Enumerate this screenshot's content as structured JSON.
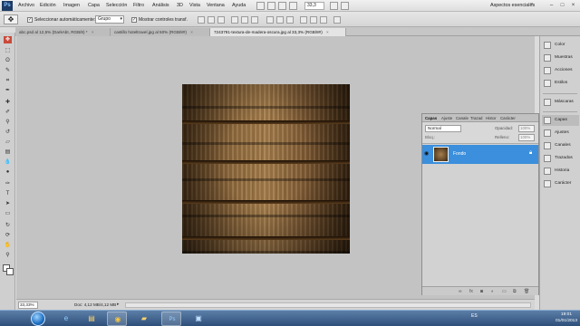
{
  "menubar": {
    "logo": "Ps",
    "items": [
      "Archivo",
      "Edición",
      "Imagen",
      "Capa",
      "Selección",
      "Filtro",
      "Análisis",
      "3D",
      "Vista",
      "Ventana",
      "Ayuda"
    ],
    "zoom": "33,3",
    "workspace": "Aspectos esenciales",
    "controls": [
      "–",
      "□",
      "×"
    ]
  },
  "options": {
    "preset_icon": "move-tool-icon",
    "auto_select_label": "Seleccionar automáticamente:",
    "auto_select_value": "Grupo",
    "show_transform_label": "Mostrar controles transf."
  },
  "tabs": [
    {
      "label": "abc.psd al 12,5% (DarkAbt, RGB/8) *",
      "active": false
    },
    {
      "label": "castillo hoteltravel.jpg al 50% (RGB/8#)",
      "active": false
    },
    {
      "label": "7243791-textura-de-madera-oscura.jpg al 33,3% (RGB/8#)",
      "active": true
    }
  ],
  "status": {
    "zoom": "33,33%",
    "doc_info": "Doc: 4,12 MB/4,12 MB"
  },
  "dock": {
    "items": [
      {
        "label": "Color",
        "icon": "color-icon"
      },
      {
        "label": "Muestras",
        "icon": "swatches-icon"
      },
      {
        "label": "Acciones",
        "icon": "actions-icon"
      },
      {
        "label": "Estilos",
        "icon": "styles-icon"
      },
      {
        "label": "Máscaras",
        "icon": "masks-icon"
      },
      {
        "label": "Capas",
        "icon": "layers-icon"
      },
      {
        "label": "Ajustes",
        "icon": "adjustments-icon"
      },
      {
        "label": "Canales",
        "icon": "channels-icon"
      },
      {
        "label": "Trazados",
        "icon": "paths-icon"
      },
      {
        "label": "Historia",
        "icon": "history-icon"
      },
      {
        "label": "Carácter",
        "icon": "character-icon"
      }
    ]
  },
  "layers": {
    "tabs": [
      "Capas",
      "Ajuste",
      "Canale",
      "Trazad",
      "Histor",
      "Carácter"
    ],
    "blend_mode": "Normal",
    "opacity_label": "Opacidad:",
    "opacity_value": "100%",
    "lock_label": "Bloq.:",
    "fill_label": "Relleno:",
    "fill_value": "100%",
    "layer_name": "Fondo",
    "footer_icons": [
      "link-icon",
      "fx-icon",
      "mask-icon",
      "adjustment-layer-icon",
      "group-icon",
      "new-layer-icon",
      "trash-icon"
    ]
  },
  "taskbar": {
    "apps": [
      "internet-explorer-icon",
      "file-explorer-icon",
      "chrome-icon",
      "folder-icon",
      "photoshop-icon",
      "network-icon"
    ],
    "tray": "ES",
    "time": "19:01",
    "date": "01/01/2013"
  }
}
